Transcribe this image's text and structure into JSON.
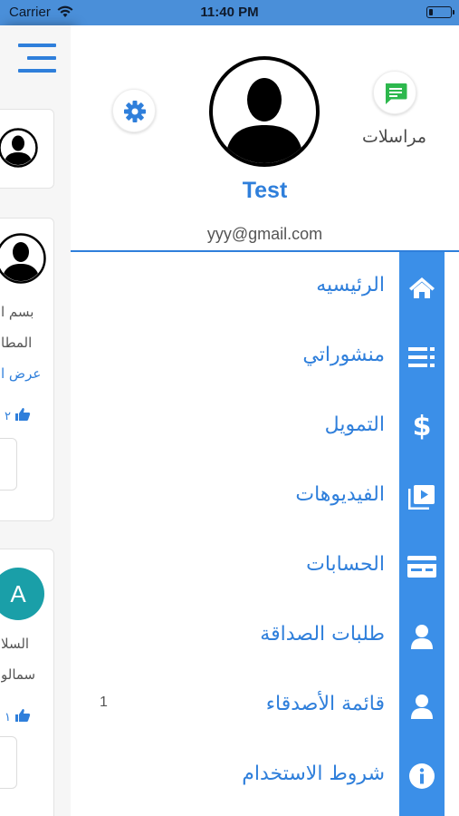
{
  "status_bar": {
    "carrier": "Carrier",
    "time": "11:40 PM"
  },
  "background_feed": {
    "post_text_line1": "بسم ا",
    "post_text_line2": "المطا",
    "show_more_link": "عرض ا",
    "like_count_1": "٢",
    "avatar_letter": "A",
    "post2_text_line1": "السلا",
    "post2_text_line2": "سمالو",
    "like_count_2": "١"
  },
  "drawer": {
    "messages_label": "مراسلات",
    "user_name": "Test",
    "user_email": "yyy@gmail.com",
    "menu": [
      {
        "label": "الرئيسيه",
        "icon": "home-icon"
      },
      {
        "label": "منشوراتي",
        "icon": "list-icon"
      },
      {
        "label": "التمويل",
        "icon": "dollar-icon"
      },
      {
        "label": "الفيديوهات",
        "icon": "video-icon"
      },
      {
        "label": "الحسابات",
        "icon": "card-icon"
      },
      {
        "label": "طلبات الصداقة",
        "icon": "user-icon"
      },
      {
        "label": "قائمة الأصدقاء",
        "icon": "user-icon",
        "count": "1"
      },
      {
        "label": "شروط الاستخدام",
        "icon": "info-icon"
      }
    ]
  },
  "colors": {
    "accent": "#2f7fdb",
    "strip": "#3b8fe8",
    "status_bar": "#4a8fd9",
    "messages_icon": "#2db84d"
  }
}
